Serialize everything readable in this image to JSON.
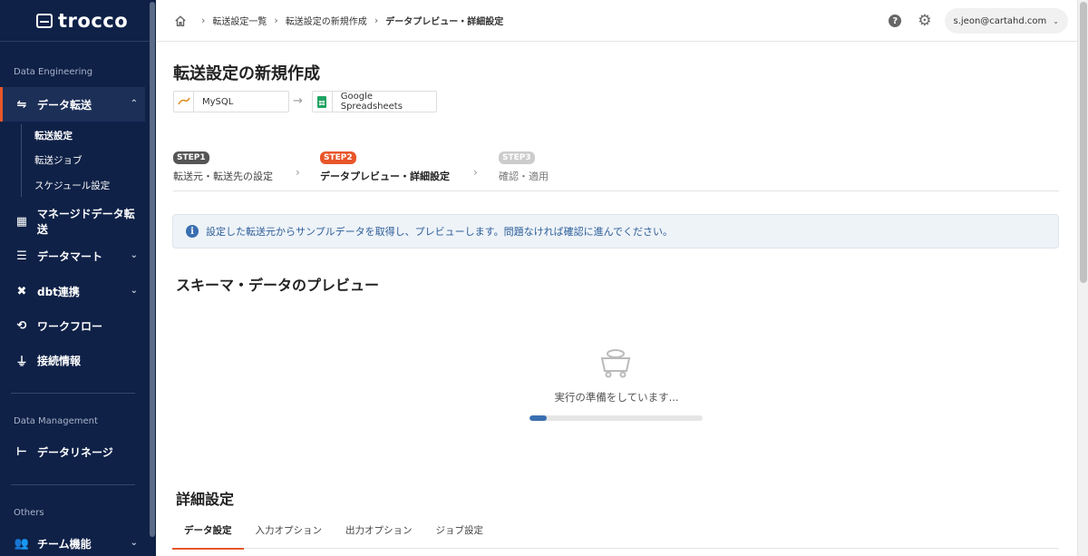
{
  "app": {
    "name": "trocco"
  },
  "sidebar": {
    "section_data_engineering": "Data Engineering",
    "section_data_management": "Data Management",
    "section_others": "Others",
    "items": {
      "transfer": "データ転送",
      "transfer_settings": "転送設定",
      "transfer_jobs": "転送ジョブ",
      "schedule": "スケジュール設定",
      "managed": "マネージドデータ転送",
      "datamart": "データマート",
      "dbt": "dbt連携",
      "workflow": "ワークフロー",
      "connections": "接続情報",
      "lineage": "データリネージ",
      "team": "チーム機能"
    }
  },
  "header": {
    "breadcrumb": [
      "転送設定一覧",
      "転送設定の新規作成",
      "データプレビュー・詳細設定"
    ],
    "user_email": "s.jeon@cartahd.com"
  },
  "page": {
    "title": "転送設定の新規作成",
    "source": "MySQL",
    "destination": "Google Spreadsheets",
    "steps": [
      {
        "badge": "STEP1",
        "label": "転送元・転送先の設定"
      },
      {
        "badge": "STEP2",
        "label": "データプレビュー・詳細設定"
      },
      {
        "badge": "STEP3",
        "label": "確認・適用"
      }
    ],
    "info": "設定した転送元からサンプルデータを取得し、プレビューします。問題なければ確認に進んでください。",
    "preview_title": "スキーマ・データのプレビュー",
    "loading_text": "実行の準備をしています...",
    "progress": 0.1,
    "detail_title": "詳細設定",
    "tabs": [
      "データ設定",
      "入力オプション",
      "出力オプション",
      "ジョブ設定"
    ]
  },
  "colors": {
    "sidebar_bg": "#0f2147",
    "accent": "#e8562a",
    "step1": "#555555",
    "step2": "#e8562a",
    "step3": "#cccccc",
    "info_text": "#2d5e99"
  },
  "icons": {
    "home": "home-icon",
    "help": "help-icon",
    "settings": "gear-icon"
  }
}
